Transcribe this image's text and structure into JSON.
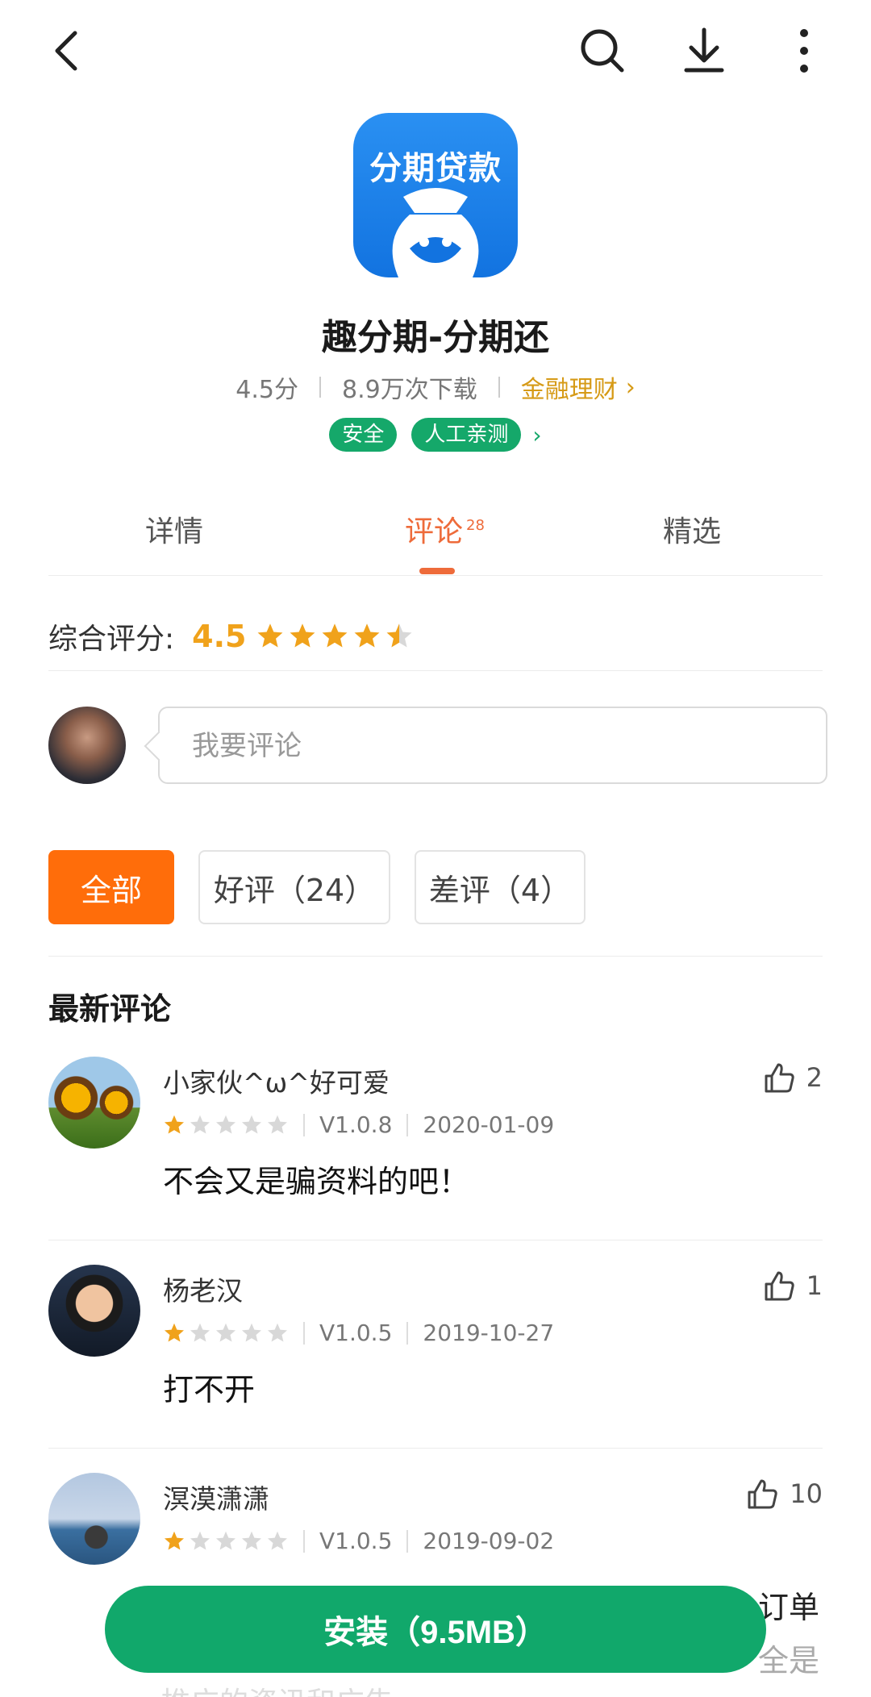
{
  "app": {
    "icon_text": "分期贷款",
    "name": "趣分期-分期还",
    "score": "4.5分",
    "downloads": "8.9万次下载",
    "category": "金融理财",
    "tags": [
      "安全",
      "人工亲测"
    ]
  },
  "tabs": [
    {
      "label": "详情"
    },
    {
      "label": "评论",
      "count": "28"
    },
    {
      "label": "精选"
    }
  ],
  "overall": {
    "label": "综合评分:",
    "score": "4.5",
    "rating": 4.5,
    "max": 5
  },
  "comment_input": {
    "placeholder": "我要评论"
  },
  "filters": [
    {
      "label": "全部",
      "active": true
    },
    {
      "label": "好评（24）",
      "active": false
    },
    {
      "label": "差评（4）",
      "active": false
    }
  ],
  "section_title": "最新评论",
  "reviews": [
    {
      "user": "小家伙^ω^好可爱",
      "rating": 1,
      "version": "V1.0.8",
      "date": "2020-01-09",
      "text": "不会又是骗资料的吧！",
      "likes": "2"
    },
    {
      "user": "杨老汉",
      "rating": 1,
      "version": "V1.0.5",
      "date": "2019-10-27",
      "text": "打不开",
      "likes": "1"
    },
    {
      "user": "溟漠潇潇",
      "rating": 1,
      "version": "V1.0.5",
      "date": "2019-09-02",
      "text": "",
      "likes": "10"
    }
  ],
  "overflow": {
    "line1": "订单",
    "line2": "全是",
    "line3": "推广的资讯和广告"
  },
  "install": {
    "label": "安装（9.5MB）"
  },
  "colors": {
    "accent": "#ee6b3a",
    "install": "#11a86b",
    "star": "#f0a21b",
    "filter_active": "#ff6d0a"
  }
}
